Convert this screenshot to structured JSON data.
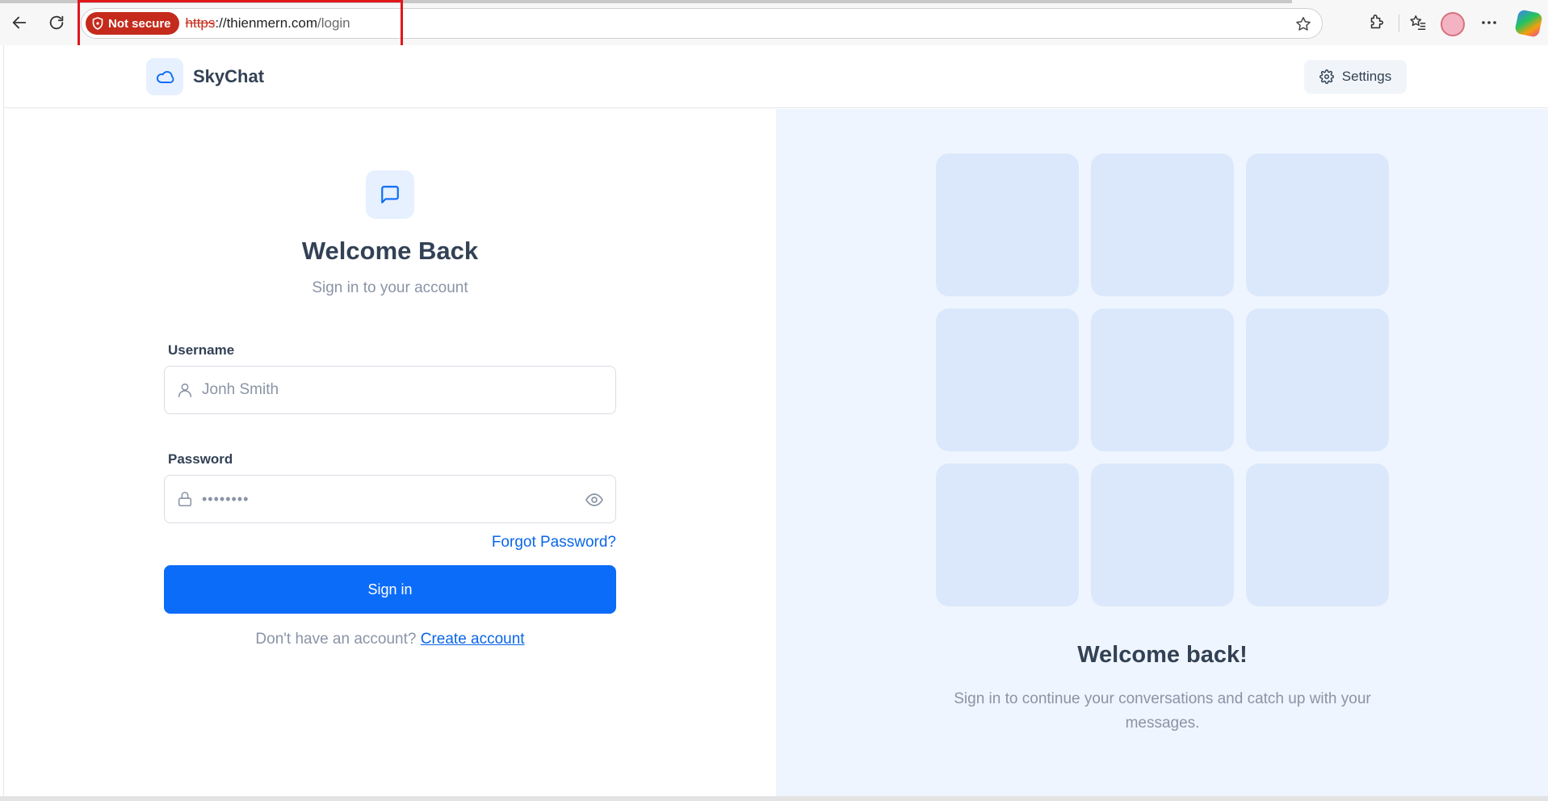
{
  "browser": {
    "security_label": "Not secure",
    "url_protocol": "https",
    "url_separator": "://",
    "url_host": "thienmern.com",
    "url_path": "/login",
    "accent_color": "#c42b1c"
  },
  "header": {
    "brand": "SkyChat",
    "settings_label": "Settings"
  },
  "login": {
    "title": "Welcome Back",
    "subtitle": "Sign in to your account",
    "username_label": "Username",
    "username_placeholder": "Jonh Smith",
    "password_label": "Password",
    "password_value": "••••••••",
    "forgot_password": "Forgot Password?",
    "sign_in": "Sign in",
    "no_account": "Don't have an account?",
    "create_account": "Create account"
  },
  "panel": {
    "title": "Welcome back!",
    "subtitle": "Sign in to continue your conversations and catch up with your messages."
  },
  "colors": {
    "primary": "#0b6cf9",
    "panel_bg": "#eff5fe",
    "tile": "#dbe8fc"
  }
}
